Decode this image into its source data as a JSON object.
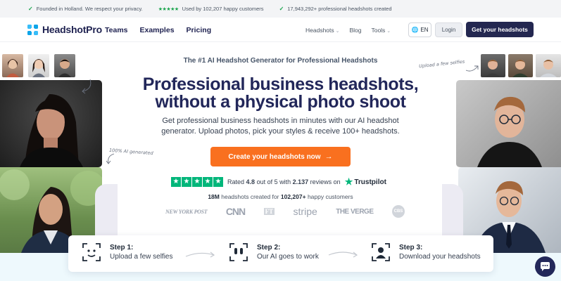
{
  "topbar": {
    "items": [
      {
        "text": "Founded in Holland. We respect your privacy."
      },
      {
        "stars": "★★★★★",
        "text": "Used by 102,207 happy customers"
      },
      {
        "text": "17,943,292+ professional headshots created"
      }
    ]
  },
  "nav": {
    "brand": "HeadshotPro",
    "main_links": [
      "Teams",
      "Examples",
      "Pricing"
    ],
    "right_links": [
      "Headshots",
      "Blog",
      "Tools"
    ],
    "lang": "EN",
    "login": "Login",
    "cta": "Get your headshots"
  },
  "hero": {
    "eyebrow": "The #1 AI Headshot Generator for Professional Headshots",
    "title_line1": "Professional business headshots,",
    "title_line2": "without a physical photo shoot",
    "subtitle_line1": "Get professional business headshots in minutes with our AI headshot",
    "subtitle_line2": "generator. Upload photos, pick your styles & receive 100+ headshots.",
    "cta": "Create your headshots now",
    "rating_prefix": "Rated",
    "rating_value": "4.8",
    "rating_mid": "out of 5 with",
    "reviews": "2.137",
    "rating_suffix": "reviews on",
    "trustpilot": "Trustpilot",
    "created_count": "18M",
    "created_mid": "headshots created for",
    "created_customers": "102,207+",
    "created_suffix": "happy customers",
    "note_left": "100% AI generated",
    "note_right": "Upload a few selfies"
  },
  "press": [
    "NEW YORK POST",
    "CNN",
    "FT",
    "stripe",
    "THE VERGE",
    "CBS"
  ],
  "steps": [
    {
      "title": "Step 1:",
      "desc": "Upload a few selfies",
      "icon": "selfie-scan-icon"
    },
    {
      "title": "Step 2:",
      "desc": "Our AI goes to work",
      "icon": "ai-face-icon"
    },
    {
      "title": "Step 3:",
      "desc": "Download your headshots",
      "icon": "headshot-icon"
    }
  ],
  "colors": {
    "navy": "#232750",
    "accent_orange": "#f9701f",
    "trustpilot_green": "#00b67a",
    "check_green": "#16a34a"
  }
}
